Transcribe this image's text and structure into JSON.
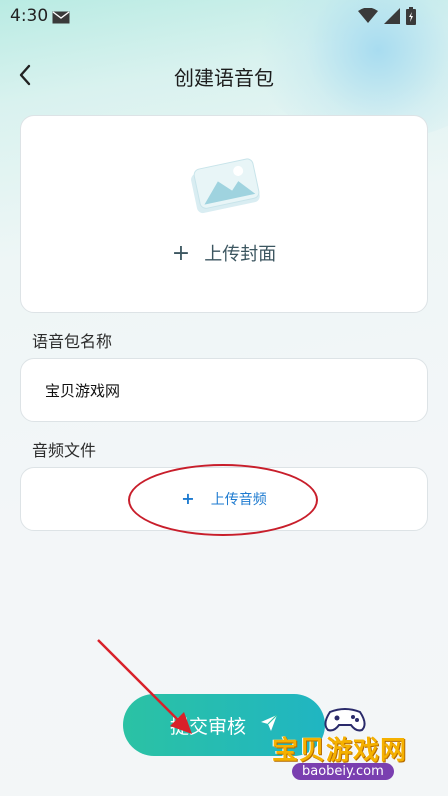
{
  "status_bar": {
    "time": "4:30",
    "icons": [
      "mail-icon",
      "wifi-icon",
      "signal-icon",
      "battery-icon"
    ]
  },
  "header": {
    "back_icon": "chevron-left-icon",
    "title": "创建语音包"
  },
  "cover": {
    "plus": "+",
    "upload_label": "上传封面",
    "icon": "image-card-icon"
  },
  "name_section": {
    "label": "语音包名称",
    "value": "宝贝游戏网"
  },
  "audio_section": {
    "label": "音频文件",
    "plus": "+",
    "upload_label": "上传音频"
  },
  "submit": {
    "label": "提交审核",
    "icon": "paper-plane-icon"
  },
  "watermark": {
    "text": "宝贝游戏网",
    "domain": "baobeiy.com"
  },
  "colors": {
    "accent_gradient_start": "#2bc2a4",
    "accent_gradient_end": "#20b5c2",
    "link_blue": "#1e7bd0",
    "annotation_red": "#c81e2b"
  }
}
